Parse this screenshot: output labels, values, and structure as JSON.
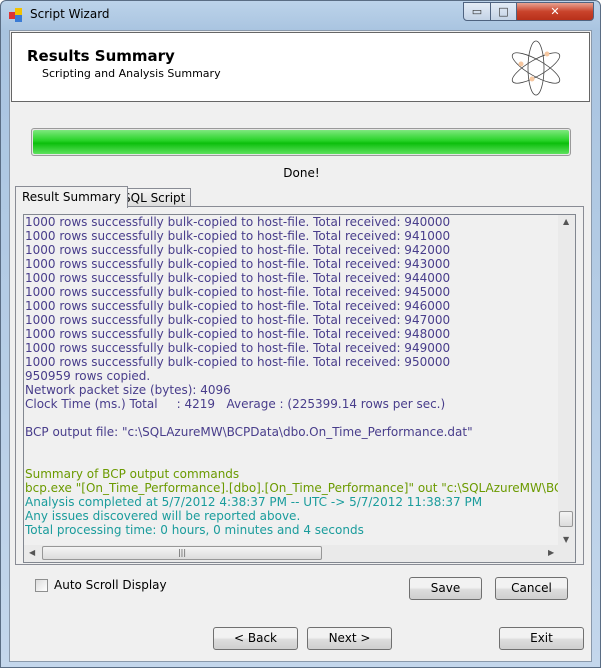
{
  "window": {
    "title": "Script Wizard",
    "controls": {
      "minimize": "▭",
      "maximize": "□",
      "close": "✕"
    }
  },
  "header": {
    "title": "Results Summary",
    "subtitle": "Scripting and Analysis Summary",
    "logo_icon": "atom-icon"
  },
  "progress": {
    "percent": 100,
    "status": "Done!",
    "color": "#1ccc1c"
  },
  "tabs": [
    {
      "label": "Result Summary",
      "active": true
    },
    {
      "label": "SQL Script",
      "active": false
    }
  ],
  "colors": {
    "log": "#483d8b",
    "summary": "#6b9a00",
    "info": "#1a9c9c"
  },
  "log_lines": [
    {
      "text": "1000 rows successfully bulk-copied to host-file. Total received: 940000",
      "kind": "log"
    },
    {
      "text": "1000 rows successfully bulk-copied to host-file. Total received: 941000",
      "kind": "log"
    },
    {
      "text": "1000 rows successfully bulk-copied to host-file. Total received: 942000",
      "kind": "log"
    },
    {
      "text": "1000 rows successfully bulk-copied to host-file. Total received: 943000",
      "kind": "log"
    },
    {
      "text": "1000 rows successfully bulk-copied to host-file. Total received: 944000",
      "kind": "log"
    },
    {
      "text": "1000 rows successfully bulk-copied to host-file. Total received: 945000",
      "kind": "log"
    },
    {
      "text": "1000 rows successfully bulk-copied to host-file. Total received: 946000",
      "kind": "log"
    },
    {
      "text": "1000 rows successfully bulk-copied to host-file. Total received: 947000",
      "kind": "log"
    },
    {
      "text": "1000 rows successfully bulk-copied to host-file. Total received: 948000",
      "kind": "log"
    },
    {
      "text": "1000 rows successfully bulk-copied to host-file. Total received: 949000",
      "kind": "log"
    },
    {
      "text": "1000 rows successfully bulk-copied to host-file. Total received: 950000",
      "kind": "log"
    },
    {
      "text": "950959 rows copied.",
      "kind": "log"
    },
    {
      "text": "Network packet size (bytes): 4096",
      "kind": "log"
    },
    {
      "text": "Clock Time (ms.) Total     : 4219   Average : (225399.14 rows per sec.)",
      "kind": "log"
    },
    {
      "text": "",
      "kind": "log"
    },
    {
      "text": "BCP output file: \"c:\\SQLAzureMW\\BCPData\\dbo.On_Time_Performance.dat\"",
      "kind": "log"
    },
    {
      "text": "",
      "kind": "log"
    },
    {
      "text": "",
      "kind": "log"
    },
    {
      "text": "Summary of BCP output commands",
      "kind": "summary"
    },
    {
      "text": "bcp.exe \"[On_Time_Performance].[dbo].[On_Time_Performance]\" out \"c:\\SQLAzureMW\\BCPDat",
      "kind": "summary"
    },
    {
      "text": "Analysis completed at 5/7/2012 4:38:37 PM -- UTC -> 5/7/2012 11:38:37 PM",
      "kind": "info"
    },
    {
      "text": "Any issues discovered will be reported above.",
      "kind": "info"
    },
    {
      "text": "Total processing time: 0 hours, 0 minutes and 4 seconds",
      "kind": "info"
    }
  ],
  "auto_scroll": {
    "label": "Auto Scroll Display",
    "checked": false
  },
  "buttons": {
    "save": "Save",
    "cancel": "Cancel",
    "back": "< Back",
    "next": "Next >",
    "exit": "Exit"
  }
}
